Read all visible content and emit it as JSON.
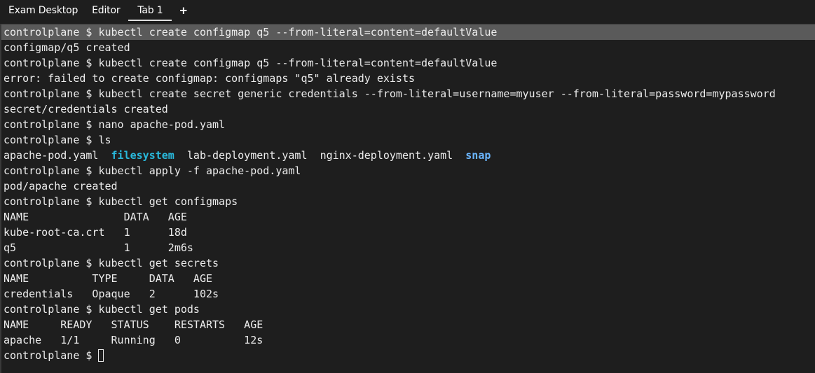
{
  "tabs": [
    {
      "label": "Exam Desktop",
      "active": false
    },
    {
      "label": "Editor",
      "active": false
    },
    {
      "label": "Tab 1",
      "active": true
    }
  ],
  "add_tab_label": "+",
  "terminal": {
    "lines": [
      "controlplane $ kubectl create configmap q5 --from-literal=content=defaultValue",
      "configmap/q5 created",
      "controlplane $ kubectl create configmap q5 --from-literal=content=defaultValue",
      "error: failed to create configmap: configmaps \"q5\" already exists",
      "controlplane $ kubectl create secret generic credentials --from-literal=username=myuser --from-literal=password=mypassword",
      "secret/credentials created",
      "controlplane $ nano apache-pod.yaml",
      "controlplane $ ls",
      "",
      "controlplane $ kubectl apply -f apache-pod.yaml",
      "pod/apache created",
      "controlplane $ kubectl get configmaps",
      "NAME               DATA   AGE",
      "kube-root-ca.crt   1      18d",
      "q5                 1      2m6s",
      "controlplane $ kubectl get secrets",
      "NAME          TYPE     DATA   AGE",
      "credentials   Opaque   2      102s",
      "controlplane $ kubectl get pods",
      "NAME     READY   STATUS    RESTARTS   AGE",
      "apache   1/1     Running   0          12s"
    ],
    "ls_output": {
      "file1": "apache-pod.yaml",
      "dir1": "filesystem",
      "file2": "lab-deployment.yaml",
      "file3": "nginx-deployment.yaml",
      "dir2": "snap"
    },
    "prompt": "controlplane $ ",
    "colors": {
      "background": "#1e1e1e",
      "foreground": "#ececec",
      "highlight": "#5a5a5a",
      "dir_cyan": "#29b8db",
      "dir_blue": "#6bb6ff"
    }
  }
}
